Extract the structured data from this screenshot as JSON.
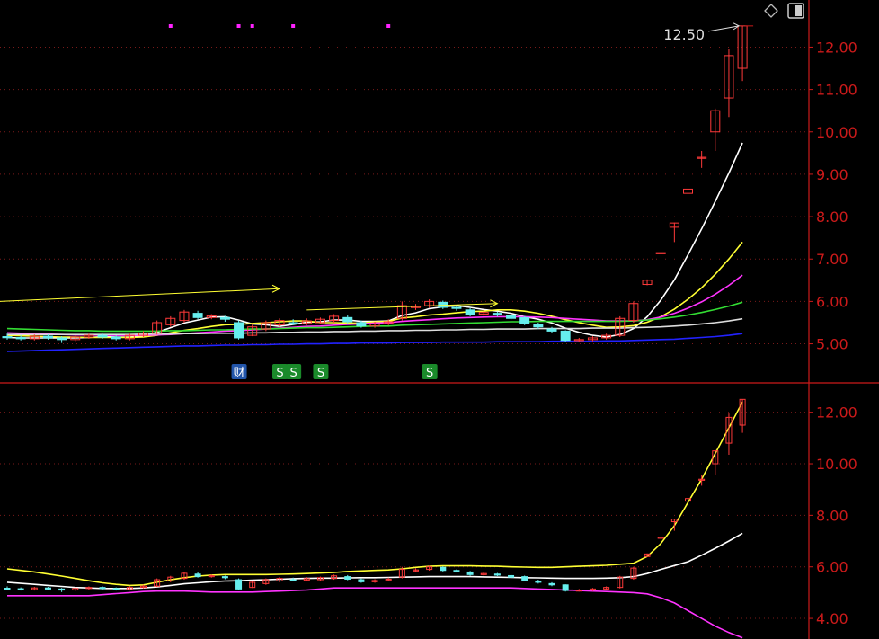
{
  "colors": {
    "background": "#000000",
    "axis": "#cc1a1a",
    "grid": "#7a1a1a",
    "up": "#ff3a3a",
    "down": "#66eeee",
    "ma5": "#ffffff",
    "ma10": "#ffff33",
    "ma20": "#ff33ff",
    "ma30": "#33dd33",
    "ma60": "#dddddd",
    "ma120": "#2222ff",
    "boll_upper": "#ffff33",
    "boll_mid": "#ffffff",
    "boll_lower": "#ff33ff",
    "marker_dot": "#ff22ff",
    "badge_s": "#1a8a2a",
    "badge_cai": "#2255aa"
  },
  "toolbar": {
    "diamond_icon": "diamond-icon",
    "panel_icon": "panel-toggle-icon"
  },
  "chart_data": [
    {
      "type": "candlestick",
      "ylim": [
        4.1,
        12.9
      ],
      "yticks": [
        "12.00",
        "11.00",
        "10.00",
        "9.00",
        "8.00",
        "7.00",
        "6.00",
        "5.00"
      ],
      "ytick_values": [
        12,
        11,
        10,
        9,
        8,
        7,
        6,
        5
      ],
      "grid": true,
      "high_annotation": "12.50",
      "high_value": 12.5,
      "candles": [
        {
          "o": 5.17,
          "c": 5.15,
          "h": 5.24,
          "l": 5.1
        },
        {
          "o": 5.15,
          "c": 5.12,
          "h": 5.2,
          "l": 5.08
        },
        {
          "o": 5.12,
          "c": 5.18,
          "h": 5.22,
          "l": 5.08
        },
        {
          "o": 5.18,
          "c": 5.14,
          "h": 5.22,
          "l": 5.1
        },
        {
          "o": 5.14,
          "c": 5.1,
          "h": 5.18,
          "l": 5.02
        },
        {
          "o": 5.1,
          "c": 5.16,
          "h": 5.2,
          "l": 5.06
        },
        {
          "o": 5.16,
          "c": 5.2,
          "h": 5.24,
          "l": 5.12
        },
        {
          "o": 5.2,
          "c": 5.16,
          "h": 5.24,
          "l": 5.12
        },
        {
          "o": 5.16,
          "c": 5.12,
          "h": 5.2,
          "l": 5.08
        },
        {
          "o": 5.12,
          "c": 5.2,
          "h": 5.24,
          "l": 5.08
        },
        {
          "o": 5.2,
          "c": 5.25,
          "h": 5.3,
          "l": 5.16
        },
        {
          "o": 5.25,
          "c": 5.5,
          "h": 5.55,
          "l": 5.22
        },
        {
          "o": 5.45,
          "c": 5.6,
          "h": 5.65,
          "l": 5.4
        },
        {
          "o": 5.55,
          "c": 5.75,
          "h": 5.8,
          "l": 5.5
        },
        {
          "o": 5.72,
          "c": 5.62,
          "h": 5.78,
          "l": 5.58
        },
        {
          "o": 5.62,
          "c": 5.66,
          "h": 5.7,
          "l": 5.58
        },
        {
          "o": 5.62,
          "c": 5.58,
          "h": 5.66,
          "l": 5.52
        },
        {
          "o": 5.5,
          "c": 5.14,
          "h": 5.55,
          "l": 5.1
        },
        {
          "o": 5.2,
          "c": 5.4,
          "h": 5.45,
          "l": 5.18
        },
        {
          "o": 5.35,
          "c": 5.5,
          "h": 5.55,
          "l": 5.3
        },
        {
          "o": 5.45,
          "c": 5.55,
          "h": 5.6,
          "l": 5.4
        },
        {
          "o": 5.5,
          "c": 5.48,
          "h": 5.58,
          "l": 5.44
        },
        {
          "o": 5.48,
          "c": 5.54,
          "h": 5.6,
          "l": 5.44
        },
        {
          "o": 5.5,
          "c": 5.58,
          "h": 5.62,
          "l": 5.46
        },
        {
          "o": 5.55,
          "c": 5.65,
          "h": 5.7,
          "l": 5.5
        },
        {
          "o": 5.62,
          "c": 5.52,
          "h": 5.68,
          "l": 5.48
        },
        {
          "o": 5.5,
          "c": 5.42,
          "h": 5.55,
          "l": 5.38
        },
        {
          "o": 5.42,
          "c": 5.47,
          "h": 5.52,
          "l": 5.38
        },
        {
          "o": 5.48,
          "c": 5.52,
          "h": 5.58,
          "l": 5.44
        },
        {
          "o": 5.6,
          "c": 5.9,
          "h": 6.0,
          "l": 5.55
        },
        {
          "o": 5.88,
          "c": 5.88,
          "h": 5.94,
          "l": 5.8
        },
        {
          "o": 5.9,
          "c": 6.0,
          "h": 6.05,
          "l": 5.85
        },
        {
          "o": 5.98,
          "c": 5.86,
          "h": 6.02,
          "l": 5.82
        },
        {
          "o": 5.86,
          "c": 5.84,
          "h": 5.9,
          "l": 5.78
        },
        {
          "o": 5.8,
          "c": 5.7,
          "h": 5.84,
          "l": 5.65
        },
        {
          "o": 5.7,
          "c": 5.74,
          "h": 5.78,
          "l": 5.66
        },
        {
          "o": 5.72,
          "c": 5.68,
          "h": 5.76,
          "l": 5.64
        },
        {
          "o": 5.66,
          "c": 5.6,
          "h": 5.7,
          "l": 5.56
        },
        {
          "o": 5.62,
          "c": 5.48,
          "h": 5.66,
          "l": 5.44
        },
        {
          "o": 5.45,
          "c": 5.4,
          "h": 5.5,
          "l": 5.35
        },
        {
          "o": 5.35,
          "c": 5.3,
          "h": 5.4,
          "l": 5.25
        },
        {
          "o": 5.3,
          "c": 5.08,
          "h": 5.32,
          "l": 5.04
        },
        {
          "o": 5.08,
          "c": 5.1,
          "h": 5.14,
          "l": 5.04
        },
        {
          "o": 5.1,
          "c": 5.14,
          "h": 5.18,
          "l": 5.06
        },
        {
          "o": 5.14,
          "c": 5.2,
          "h": 5.24,
          "l": 5.1
        },
        {
          "o": 5.2,
          "c": 5.6,
          "h": 5.65,
          "l": 5.16
        },
        {
          "o": 5.55,
          "c": 5.95,
          "h": 6.0,
          "l": 5.5
        },
        {
          "o": 6.4,
          "c": 6.5,
          "h": 6.52,
          "l": 6.38
        },
        {
          "o": 7.15,
          "c": 7.15,
          "h": 7.15,
          "l": 7.15
        },
        {
          "o": 7.75,
          "c": 7.85,
          "h": 7.86,
          "l": 7.4
        },
        {
          "o": 8.55,
          "c": 8.65,
          "h": 8.66,
          "l": 8.35
        },
        {
          "o": 9.4,
          "c": 9.4,
          "h": 9.55,
          "l": 9.15
        },
        {
          "o": 10.0,
          "c": 10.5,
          "h": 10.55,
          "l": 9.55
        },
        {
          "o": 10.8,
          "c": 11.8,
          "h": 11.95,
          "l": 10.35
        },
        {
          "o": 11.5,
          "c": 12.5,
          "h": 12.5,
          "l": 11.2
        }
      ],
      "series": [
        {
          "color_key": "ma5",
          "values": [
            5.15,
            5.14,
            5.14,
            5.14,
            5.14,
            5.14,
            5.15,
            5.17,
            5.16,
            5.16,
            5.19,
            5.27,
            5.38,
            5.49,
            5.56,
            5.63,
            5.64,
            5.56,
            5.47,
            5.45,
            5.41,
            5.46,
            5.51,
            5.52,
            5.56,
            5.56,
            5.53,
            5.53,
            5.54,
            5.67,
            5.73,
            5.83,
            5.87,
            5.9,
            5.86,
            5.81,
            5.77,
            5.72,
            5.64,
            5.58,
            5.49,
            5.37,
            5.27,
            5.2,
            5.16,
            5.22,
            5.36,
            5.64,
            6.03,
            6.51,
            7.1,
            7.71,
            8.36,
            9.03,
            9.74
          ]
        },
        {
          "color_key": "ma10",
          "values": [
            5.2,
            5.19,
            5.18,
            5.17,
            5.16,
            5.16,
            5.15,
            5.15,
            5.15,
            5.15,
            5.16,
            5.2,
            5.26,
            5.32,
            5.36,
            5.41,
            5.45,
            5.46,
            5.48,
            5.5,
            5.52,
            5.54,
            5.54,
            5.5,
            5.5,
            5.49,
            5.49,
            5.52,
            5.53,
            5.61,
            5.64,
            5.68,
            5.7,
            5.73,
            5.76,
            5.77,
            5.8,
            5.8,
            5.77,
            5.72,
            5.65,
            5.57,
            5.5,
            5.44,
            5.39,
            5.4,
            5.43,
            5.51,
            5.64,
            5.82,
            6.05,
            6.32,
            6.64,
            7.0,
            7.4
          ]
        },
        {
          "color_key": "ma20",
          "values": [
            5.26,
            5.25,
            5.24,
            5.23,
            5.22,
            5.21,
            5.21,
            5.2,
            5.2,
            5.2,
            5.2,
            5.21,
            5.22,
            5.24,
            5.26,
            5.28,
            5.3,
            5.31,
            5.33,
            5.35,
            5.37,
            5.39,
            5.41,
            5.42,
            5.44,
            5.46,
            5.47,
            5.49,
            5.5,
            5.53,
            5.55,
            5.57,
            5.59,
            5.61,
            5.62,
            5.63,
            5.64,
            5.64,
            5.64,
            5.63,
            5.62,
            5.6,
            5.58,
            5.56,
            5.54,
            5.54,
            5.54,
            5.57,
            5.63,
            5.72,
            5.84,
            5.99,
            6.17,
            6.38,
            6.62
          ]
        },
        {
          "color_key": "ma30",
          "values": [
            5.36,
            5.35,
            5.34,
            5.33,
            5.32,
            5.31,
            5.31,
            5.3,
            5.3,
            5.3,
            5.3,
            5.3,
            5.31,
            5.31,
            5.32,
            5.33,
            5.33,
            5.34,
            5.35,
            5.35,
            5.36,
            5.37,
            5.38,
            5.38,
            5.39,
            5.4,
            5.41,
            5.42,
            5.42,
            5.44,
            5.45,
            5.46,
            5.47,
            5.48,
            5.49,
            5.5,
            5.51,
            5.52,
            5.52,
            5.53,
            5.53,
            5.53,
            5.53,
            5.53,
            5.53,
            5.53,
            5.54,
            5.56,
            5.59,
            5.63,
            5.68,
            5.74,
            5.81,
            5.89,
            5.98
          ]
        },
        {
          "color_key": "ma60",
          "values": [
            5.22,
            5.22,
            5.22,
            5.22,
            5.22,
            5.22,
            5.22,
            5.22,
            5.22,
            5.22,
            5.23,
            5.23,
            5.23,
            5.24,
            5.24,
            5.25,
            5.25,
            5.25,
            5.26,
            5.26,
            5.27,
            5.27,
            5.28,
            5.28,
            5.29,
            5.29,
            5.3,
            5.3,
            5.31,
            5.31,
            5.32,
            5.32,
            5.33,
            5.33,
            5.34,
            5.34,
            5.35,
            5.35,
            5.35,
            5.36,
            5.36,
            5.36,
            5.36,
            5.37,
            5.37,
            5.37,
            5.38,
            5.39,
            5.4,
            5.42,
            5.44,
            5.47,
            5.5,
            5.54,
            5.59
          ]
        },
        {
          "color_key": "ma120",
          "values": [
            4.82,
            4.83,
            4.84,
            4.85,
            4.86,
            4.87,
            4.88,
            4.89,
            4.9,
            4.91,
            4.92,
            4.93,
            4.94,
            4.95,
            4.95,
            4.96,
            4.97,
            4.97,
            4.98,
            4.98,
            4.99,
            4.99,
            5.0,
            5.0,
            5.01,
            5.01,
            5.02,
            5.02,
            5.02,
            5.03,
            5.03,
            5.03,
            5.04,
            5.04,
            5.04,
            5.04,
            5.05,
            5.05,
            5.05,
            5.05,
            5.06,
            5.06,
            5.06,
            5.06,
            5.07,
            5.07,
            5.08,
            5.09,
            5.1,
            5.11,
            5.13,
            5.15,
            5.17,
            5.2,
            5.24
          ]
        }
      ],
      "trend_arrows": [
        {
          "color_key": "boll_upper",
          "from": [
            0,
            6.0
          ],
          "to": [
            20,
            6.3
          ]
        },
        {
          "color_key": "boll_upper",
          "from": [
            22,
            5.8
          ],
          "to": [
            36,
            5.95
          ]
        }
      ],
      "markers_dots": [
        12,
        17,
        18,
        21,
        28
      ],
      "signal_badges": [
        {
          "index": 17,
          "label": "财",
          "color_key": "badge_cai"
        },
        {
          "index": 20,
          "label": "S",
          "color_key": "badge_s"
        },
        {
          "index": 21,
          "label": "S",
          "color_key": "badge_s"
        },
        {
          "index": 23,
          "label": "S",
          "color_key": "badge_s"
        },
        {
          "index": 31,
          "label": "S",
          "color_key": "badge_s"
        }
      ]
    },
    {
      "type": "candlestick",
      "ylim": [
        3.2,
        13.0
      ],
      "yticks": [
        "12.00",
        "10.00",
        "8.00",
        "6.00",
        "4.00"
      ],
      "ytick_values": [
        12,
        10,
        8,
        6,
        4
      ],
      "grid": true,
      "series": [
        {
          "color_key": "boll_upper",
          "values": [
            5.92,
            5.86,
            5.8,
            5.72,
            5.64,
            5.55,
            5.46,
            5.38,
            5.32,
            5.28,
            5.3,
            5.4,
            5.5,
            5.58,
            5.64,
            5.68,
            5.7,
            5.7,
            5.7,
            5.7,
            5.71,
            5.72,
            5.74,
            5.76,
            5.78,
            5.82,
            5.84,
            5.86,
            5.88,
            5.92,
            5.98,
            6.02,
            6.04,
            6.04,
            6.04,
            6.03,
            6.02,
            6.0,
            5.99,
            5.98,
            5.98,
            6.0,
            6.02,
            6.04,
            6.06,
            6.1,
            6.14,
            6.4,
            6.9,
            7.6,
            8.5,
            9.4,
            10.4,
            11.4,
            12.4
          ]
        },
        {
          "color_key": "boll_mid",
          "values": [
            5.4,
            5.36,
            5.32,
            5.28,
            5.24,
            5.2,
            5.18,
            5.16,
            5.16,
            5.16,
            5.18,
            5.22,
            5.28,
            5.34,
            5.38,
            5.42,
            5.45,
            5.46,
            5.48,
            5.5,
            5.52,
            5.54,
            5.55,
            5.56,
            5.56,
            5.57,
            5.58,
            5.58,
            5.59,
            5.6,
            5.61,
            5.62,
            5.62,
            5.62,
            5.62,
            5.61,
            5.6,
            5.59,
            5.58,
            5.57,
            5.56,
            5.55,
            5.55,
            5.55,
            5.56,
            5.58,
            5.62,
            5.74,
            5.9,
            6.05,
            6.2,
            6.45,
            6.72,
            7.0,
            7.3
          ]
        },
        {
          "color_key": "boll_lower",
          "values": [
            4.88,
            4.88,
            4.88,
            4.88,
            4.88,
            4.88,
            4.88,
            4.92,
            4.96,
            5.0,
            5.04,
            5.06,
            5.06,
            5.06,
            5.04,
            5.02,
            5.02,
            5.02,
            5.02,
            5.04,
            5.06,
            5.08,
            5.1,
            5.14,
            5.18,
            5.18,
            5.18,
            5.18,
            5.18,
            5.18,
            5.18,
            5.18,
            5.18,
            5.18,
            5.18,
            5.18,
            5.18,
            5.18,
            5.16,
            5.14,
            5.12,
            5.1,
            5.08,
            5.06,
            5.04,
            5.02,
            5.0,
            4.95,
            4.8,
            4.6,
            4.3,
            4.0,
            3.7,
            3.45,
            3.25
          ]
        }
      ]
    }
  ]
}
